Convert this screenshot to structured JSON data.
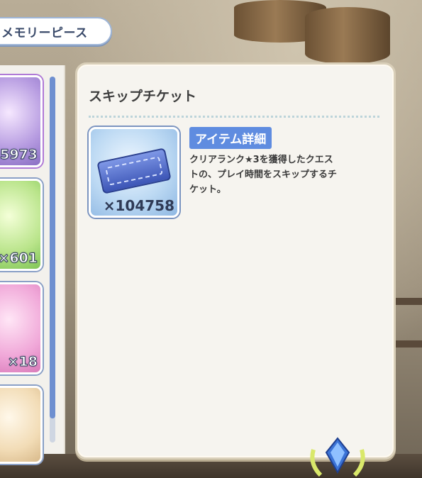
{
  "title_tab": {
    "label": "メモリーピース"
  },
  "item_list": {
    "items": [
      {
        "count": "5973"
      },
      {
        "count": "×601"
      },
      {
        "count": "×18"
      },
      {
        "count": ""
      }
    ]
  },
  "detail": {
    "title": "スキップチケット",
    "item_count": "×104758",
    "tag": "アイテム詳細",
    "description_lines": [
      "クリアランク★3を獲得したクエス",
      "トの、プレイ時間をスキップするチ",
      "ケット。"
    ]
  },
  "colors": {
    "accent": "#5f8ce0",
    "panel_bg": "#f6f4ef",
    "scroll_thumb": "#6e8fd0"
  },
  "icons": {
    "ticket": "skip-ticket-icon",
    "emblem": "crystal-emblem-icon"
  }
}
